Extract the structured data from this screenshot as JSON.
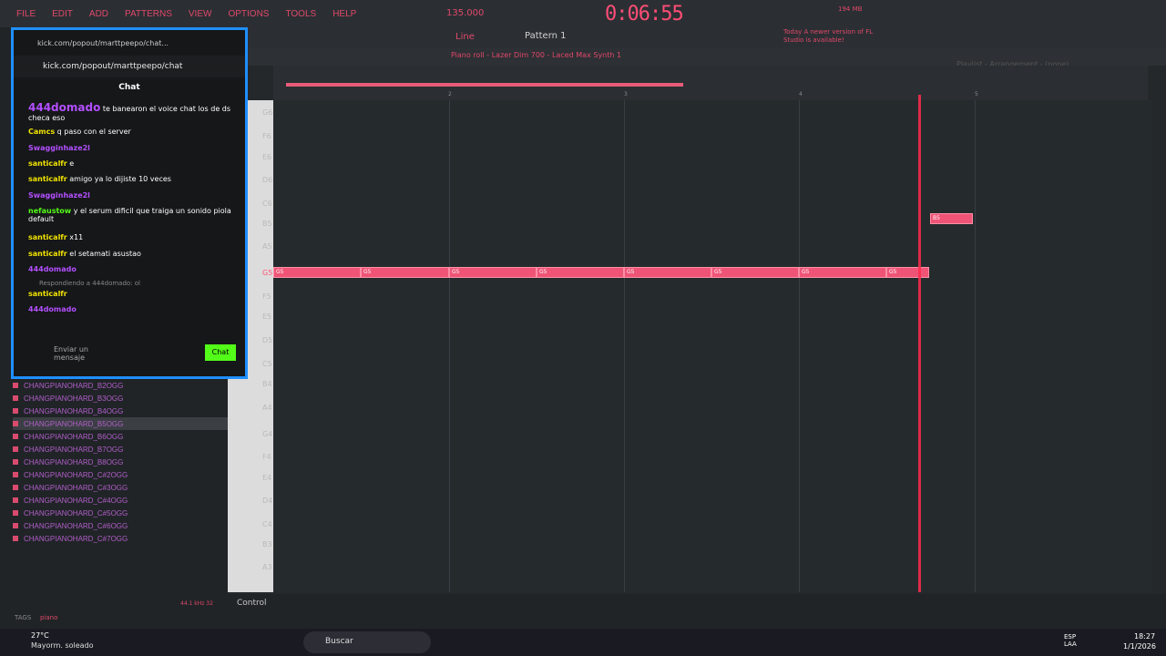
{
  "menu": [
    "FILE",
    "EDIT",
    "ADD",
    "PATTERNS",
    "VIEW",
    "OPTIONS",
    "TOOLS",
    "HELP"
  ],
  "transport": {
    "tempo": "135.000",
    "time": "0:06:55",
    "pattern": "Pattern 1",
    "mem": "194 MB",
    "line": "Line",
    "notice": "Today  A newer version of FL Studio is available!"
  },
  "pianoroll": {
    "title": "Piano roll - Lazer Dim 700 - Laced Max Synth 1",
    "playlist": "Playlist - Arrangement - (none)",
    "bars": [
      "2",
      "3",
      "4",
      "5"
    ],
    "control": "Control"
  },
  "keys": [
    "G6",
    "F6",
    "E6",
    "D6",
    "C6",
    "B5",
    "A5",
    "G5",
    "F5",
    "E5",
    "D5",
    "C5",
    "B4",
    "A4",
    "G4",
    "F4",
    "E4",
    "D4",
    "C4",
    "B3",
    "A3"
  ],
  "notes": {
    "g5_label": "G5",
    "b5_label": "B5"
  },
  "chat": {
    "tabtitle": "kick.com/popout/marttpeepo/chat...",
    "url": "kick.com/popout/marttpeepo/chat",
    "title": "Chat",
    "messages": [
      {
        "user": "444domado",
        "text": "te banearon el voice chat los de ds checa eso"
      },
      {
        "user": "Camcs",
        "text": "q paso con el server"
      },
      {
        "user": "Swagginhaze2l",
        "text": ""
      },
      {
        "user": "santicalfr",
        "text": "e"
      },
      {
        "user": "santicalfr",
        "text": "amigo ya lo dijiste 10 veces"
      },
      {
        "user": "Swagginhaze2l",
        "text": ""
      },
      {
        "user": "nefaustow",
        "text": "y el serum dificil que traiga un sonido piola default"
      },
      {
        "user": "santicalfr",
        "text": "x11"
      },
      {
        "user": "santicalfr",
        "text": "el setamati asustao"
      },
      {
        "user": "444domado",
        "text": ""
      },
      {
        "user": "santicalfr",
        "text": ""
      },
      {
        "user": "444domado",
        "text": ""
      }
    ],
    "reply": "Respondiendo a 444domado: ol",
    "input_placeholder": "Enviar un mensaje",
    "send": "Chat"
  },
  "browser": [
    "CHANGPIANOHARD_B2OGG",
    "CHANGPIANOHARD_B3OGG",
    "CHANGPIANOHARD_B4OGG",
    "CHANGPIANOHARD_B5OGG",
    "CHANGPIANOHARD_B6OGG",
    "CHANGPIANOHARD_B7OGG",
    "CHANGPIANOHARD_B8OGG",
    "CHANGPIANOHARD_C#2OGG",
    "CHANGPIANOHARD_C#3OGG",
    "CHANGPIANOHARD_C#4OGG",
    "CHANGPIANOHARD_C#5OGG",
    "CHANGPIANOHARD_C#6OGG",
    "CHANGPIANOHARD_C#7OGG"
  ],
  "tags": {
    "label": "TAGS",
    "value": "piano",
    "rate": "44.1 kHz 32"
  },
  "taskbar": {
    "temp": "27°C",
    "weather": "Mayorm. soleado",
    "search": "Buscar",
    "lang": "ESP LAA",
    "time": "18:27",
    "date": "1/1/2026"
  }
}
